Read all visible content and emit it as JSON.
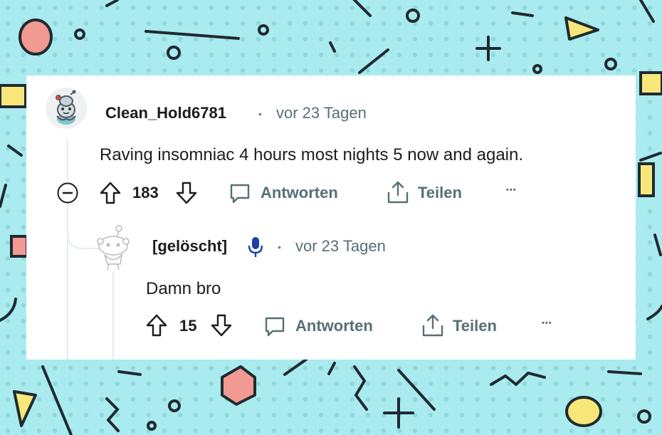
{
  "comment": {
    "username": "Clean_Hold6781",
    "separator": "•",
    "timestamp": "vor 23 Tagen",
    "text": "Raving insomniac 4 hours most nights 5 now and again.",
    "score": "183",
    "reply_label": "Antworten",
    "share_label": "Teilen",
    "more_label": "•••"
  },
  "reply": {
    "username": "[gelöscht]",
    "separator": "•",
    "timestamp": "vor 23 Tagen",
    "text": "Damn bro",
    "score": "15",
    "reply_label": "Antworten",
    "share_label": "Teilen",
    "more_label": "•••"
  },
  "icons": {
    "collapse": "minus-circle-icon",
    "upvote": "arrow-up-icon",
    "downvote": "arrow-down-icon",
    "reply": "speech-bubble-icon",
    "share": "share-icon",
    "mic": "microphone-icon"
  },
  "colors": {
    "background": "#a9ebee",
    "card": "#ffffff",
    "meta_text": "#576f76",
    "mic_blue": "#1a3fa8"
  }
}
